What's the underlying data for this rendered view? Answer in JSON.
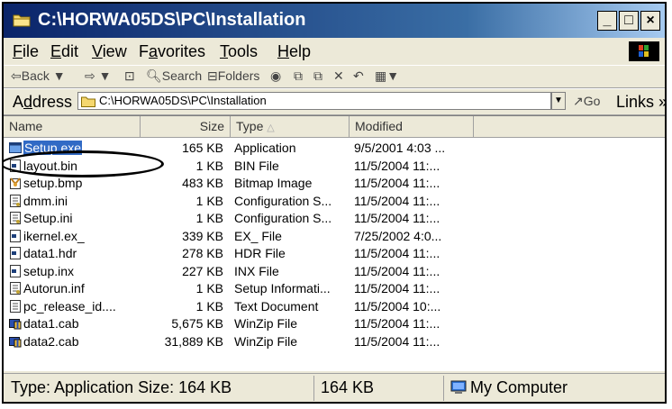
{
  "window": {
    "title": "C:\\HORWA05DS\\PC\\Installation",
    "controls": {
      "minimize": "_",
      "maximize": "□",
      "close": "×"
    }
  },
  "menu": {
    "file": {
      "u": "F",
      "rest": "ile"
    },
    "edit": {
      "u": "E",
      "rest": "dit"
    },
    "view": {
      "u": "V",
      "rest": "iew"
    },
    "favorites": {
      "pre": "F",
      "u": "a",
      "rest": "vorites"
    },
    "tools": {
      "u": "T",
      "rest": "ools"
    },
    "help": {
      "u": "H",
      "rest": "elp"
    }
  },
  "toolbar": {
    "back": "⇦Back ▼",
    "forward": "⇨ ▼",
    "up": "⊡",
    "search": "Search",
    "folders": "Folders",
    "history": "◉",
    "move": "⧉",
    "copy": "⧉",
    "delete": "✕",
    "undo": "↶",
    "views": "▦▼"
  },
  "address": {
    "label_pre": "A",
    "label_u": "d",
    "label_rest": "dress",
    "value": "C:\\HORWA05DS\\PC\\Installation",
    "go": "Go",
    "links": "Links »"
  },
  "columns": {
    "name": "Name",
    "size": "Size",
    "type": "Type",
    "sort": "△",
    "modified": "Modified"
  },
  "files": [
    {
      "name": "Setup.exe",
      "size": "165 KB",
      "type": "Application",
      "modified": "9/5/2001 4:03 ...",
      "icon": "application-icon"
    },
    {
      "name": "layout.bin",
      "size": "1 KB",
      "type": "BIN File",
      "modified": "11/5/2004 11:...",
      "icon": "generic-file-icon"
    },
    {
      "name": "setup.bmp",
      "size": "483 KB",
      "type": "Bitmap Image",
      "modified": "11/5/2004 11:...",
      "icon": "bitmap-icon"
    },
    {
      "name": "dmm.ini",
      "size": "1 KB",
      "type": "Configuration S...",
      "modified": "11/5/2004 11:...",
      "icon": "config-file-icon"
    },
    {
      "name": "Setup.ini",
      "size": "1 KB",
      "type": "Configuration S...",
      "modified": "11/5/2004 11:...",
      "icon": "config-file-icon"
    },
    {
      "name": "ikernel.ex_",
      "size": "339 KB",
      "type": "EX_ File",
      "modified": "7/25/2002 4:0...",
      "icon": "generic-file-icon"
    },
    {
      "name": "data1.hdr",
      "size": "278 KB",
      "type": "HDR File",
      "modified": "11/5/2004 11:...",
      "icon": "generic-file-icon"
    },
    {
      "name": "setup.inx",
      "size": "227 KB",
      "type": "INX File",
      "modified": "11/5/2004 11:...",
      "icon": "generic-file-icon"
    },
    {
      "name": "Autorun.inf",
      "size": "1 KB",
      "type": "Setup Informati...",
      "modified": "11/5/2004 11:...",
      "icon": "config-file-icon"
    },
    {
      "name": "pc_release_id....",
      "size": "1 KB",
      "type": "Text Document",
      "modified": "11/5/2004 10:...",
      "icon": "text-file-icon"
    },
    {
      "name": "data1.cab",
      "size": "5,675 KB",
      "type": "WinZip File",
      "modified": "11/5/2004 11:...",
      "icon": "winzip-icon"
    },
    {
      "name": "data2.cab",
      "size": "31,889 KB",
      "type": "WinZip File",
      "modified": "11/5/2004 11:...",
      "icon": "winzip-icon"
    }
  ],
  "status": {
    "info": "Type: Application Size: 164 KB",
    "size": "164 KB",
    "zone": "My Computer"
  },
  "colors": {
    "titlebar": "#0a246a",
    "selection": "#316ac5",
    "chrome": "#ece9d8"
  }
}
